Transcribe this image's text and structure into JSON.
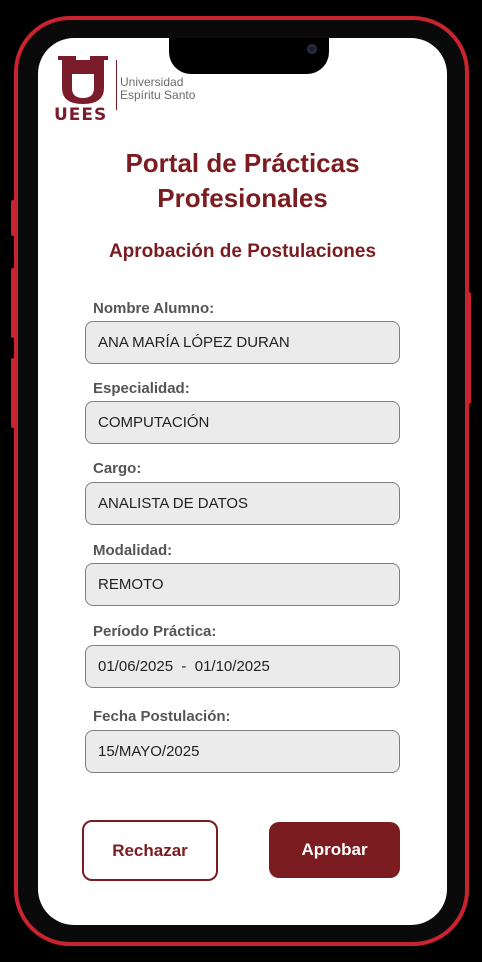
{
  "brand": {
    "logo_letter": "U",
    "logo_wordmark": "UEES",
    "university_line1": "Universidad",
    "university_line2": "Espíritu Santo"
  },
  "page": {
    "title_line1": "Portal de Prácticas",
    "title_line2": "Profesionales",
    "subtitle": "Aprobación de Postulaciones"
  },
  "form": {
    "student_label": "Nombre Alumno:",
    "student_value": "ANA MARÍA LÓPEZ DURAN",
    "specialty_label": "Especialidad:",
    "specialty_value": "COMPUTACIÓN",
    "position_label": "Cargo:",
    "position_value": "ANALISTA DE DATOS",
    "modality_label": "Modalidad:",
    "modality_value": "REMOTO",
    "period_label": "Período Práctica:",
    "period_value": "01/06/2025  -  01/10/2025",
    "date_label": "Fecha Postulación:",
    "date_value": "15/MAYO/2025"
  },
  "actions": {
    "reject_label": "Rechazar",
    "approve_label": "Aprobar"
  },
  "colors": {
    "brand": "#7b1c20",
    "device_frame": "#c8232e",
    "field_bg": "#ebebeb"
  }
}
